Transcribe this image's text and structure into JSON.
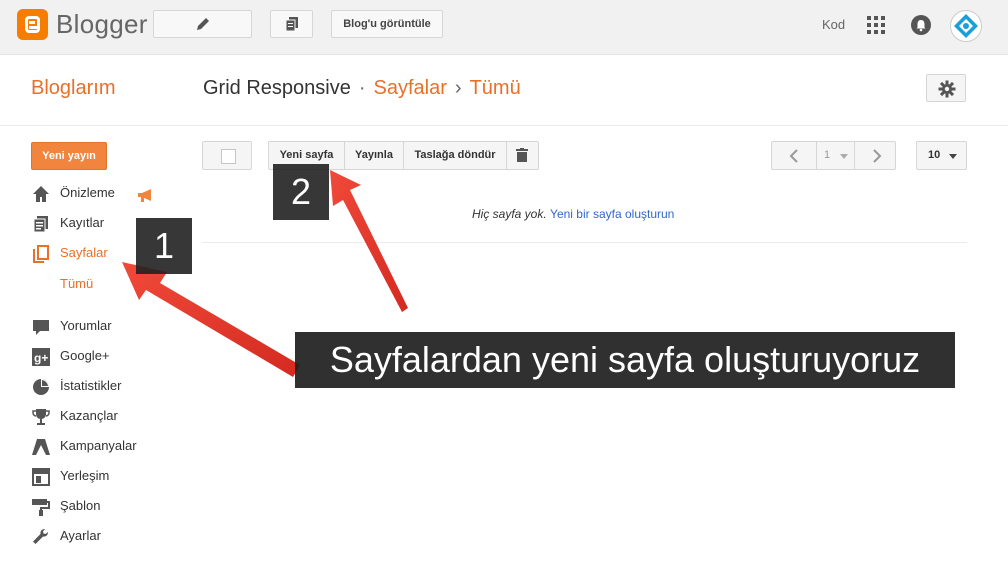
{
  "topbar": {
    "logo_text": "Blogger",
    "view_blog_label": "Blog'u görüntüle",
    "user_name": "Kod"
  },
  "header": {
    "title": "Bloglarım",
    "blog_name": "Grid Responsive",
    "separator1": "·",
    "section": "Sayfalar",
    "separator2": "›",
    "subsection": "Tümü"
  },
  "sidebar": {
    "new_post_label": "Yeni yayın",
    "items": [
      {
        "label": "Önizleme",
        "icon": "home-icon"
      },
      {
        "label": "Kayıtlar",
        "icon": "posts-icon"
      },
      {
        "label": "Sayfalar",
        "icon": "pages-icon",
        "active": true
      },
      {
        "label": "Yorumlar",
        "icon": "comments-icon"
      },
      {
        "label": "Google+",
        "icon": "google-plus-icon"
      },
      {
        "label": "İstatistikler",
        "icon": "stats-icon"
      },
      {
        "label": "Kazançlar",
        "icon": "trophy-icon"
      },
      {
        "label": "Kampanyalar",
        "icon": "campaigns-icon"
      },
      {
        "label": "Yerleşim",
        "icon": "layout-icon"
      },
      {
        "label": "Şablon",
        "icon": "template-icon"
      },
      {
        "label": "Ayarlar",
        "icon": "wrench-icon"
      }
    ],
    "sub_item_label": "Tümü"
  },
  "toolbar": {
    "new_page_label": "Yeni sayfa",
    "publish_label": "Yayınla",
    "revert_label": "Taslağa döndür",
    "page_number": "1",
    "per_page": "10"
  },
  "content": {
    "empty_text": "Hiç sayfa yok.",
    "create_link": "Yeni bir sayfa oluşturun"
  },
  "annotations": {
    "badge1": "1",
    "badge2": "2",
    "caption": "Sayfalardan yeni sayfa oluşturuyoruz"
  },
  "colors": {
    "accent": "#e8702a",
    "button_orange": "#f1853d",
    "arrow_red": "#e8352a"
  }
}
